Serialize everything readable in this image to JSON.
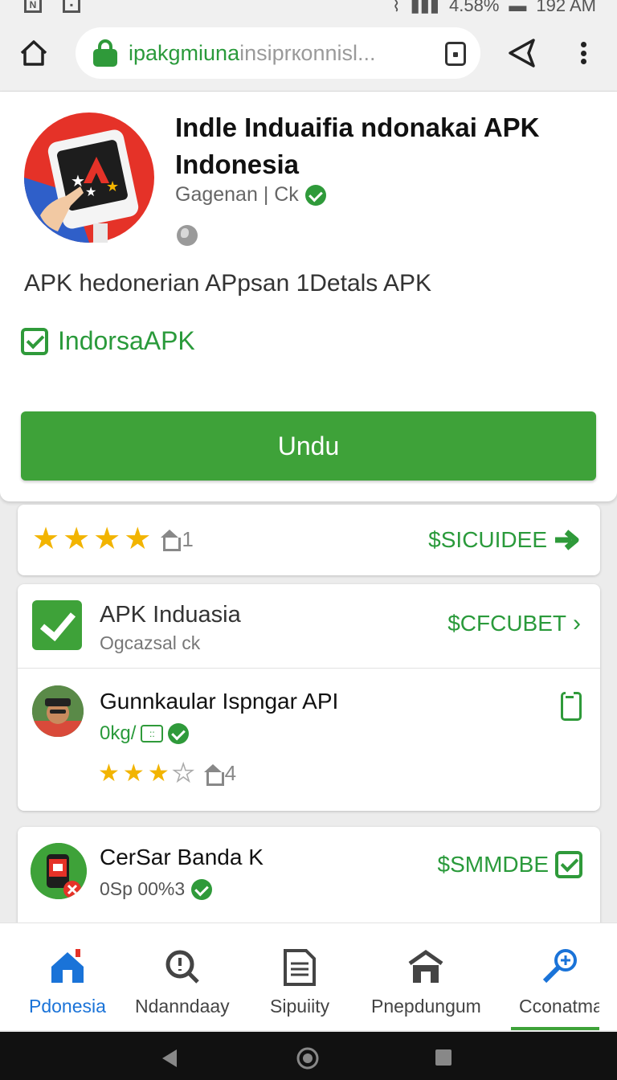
{
  "status_bar": {
    "time": "192 AM",
    "battery": "4.58%"
  },
  "browser": {
    "url_host": "ipakgmiuna",
    "url_rest": "insiprкonnisl..."
  },
  "app": {
    "title": "Indle Induaifia ndonakai APK Indonesia",
    "developer": "Gagenan | Ck",
    "subtitle": "APK hedonerian APpsan 1Detals APK",
    "badge": "IndorsaAPK",
    "download_label": "Undu"
  },
  "rating_card": {
    "stars": 4,
    "count": "1",
    "link": "$SICUIDEE"
  },
  "list_card": {
    "item1": {
      "title": "APK Induasia",
      "subtitle": "Ogcazsal ck",
      "link": "$CFCUBET"
    },
    "item2": {
      "title": "Gunnkaular Ispngar API",
      "subtitle": "0kg/",
      "stars": 3,
      "count": "4"
    }
  },
  "app_card": {
    "title": "CerSar Banda K",
    "subtitle": "0Sp 00%3",
    "link": "$SMMDBE"
  },
  "bottom_nav": [
    {
      "label": "Pdonesia",
      "icon": "home-icon",
      "active": true
    },
    {
      "label": "Ndanndaay",
      "icon": "search-icon",
      "active": false
    },
    {
      "label": "Sipuiity",
      "icon": "document-icon",
      "active": false
    },
    {
      "label": "Pnepdungum",
      "icon": "store-icon",
      "active": false
    },
    {
      "label": "Cconatma",
      "icon": "zoom-icon",
      "active": false
    }
  ],
  "colors": {
    "accent_green": "#3ea239",
    "link_green": "#2a9a3b",
    "active_blue": "#1a73d8",
    "star": "#f2b400"
  }
}
